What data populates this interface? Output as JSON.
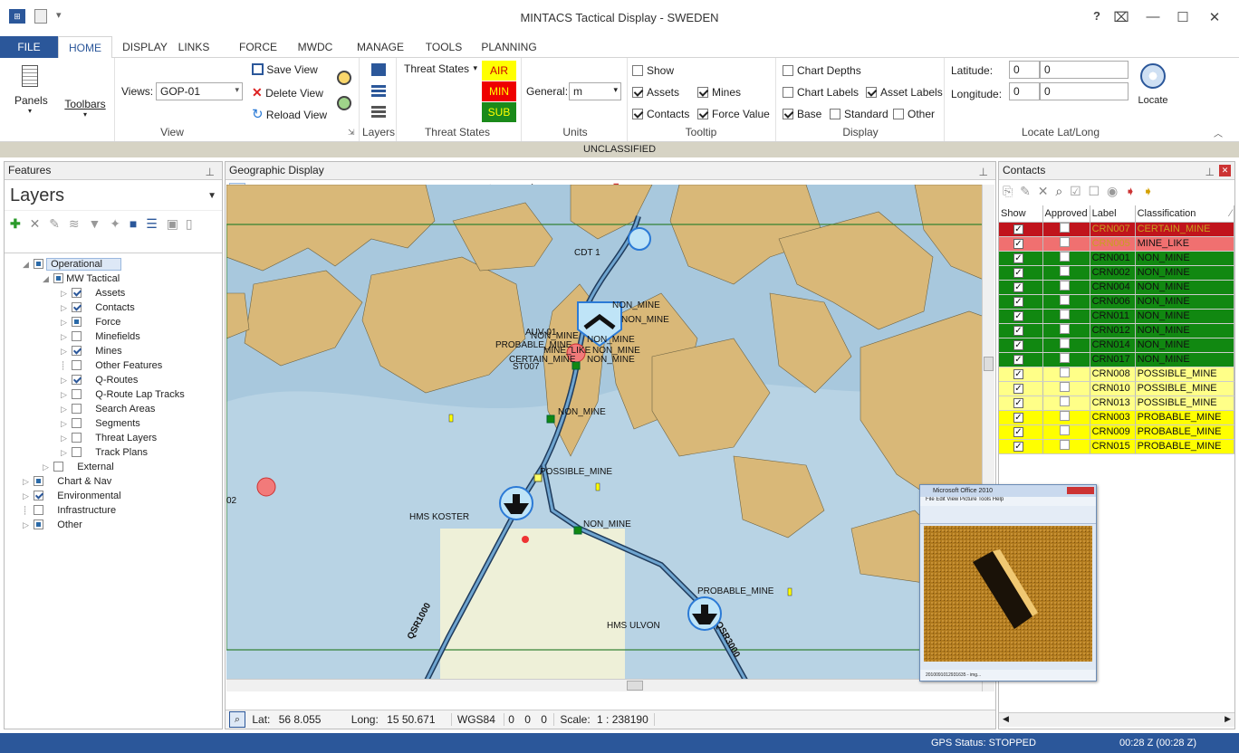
{
  "window": {
    "title": "MINTACS Tactical Display - SWEDEN",
    "help": "?",
    "restore": "⌧",
    "minimize": "—",
    "maximize": "☐",
    "close": "✕"
  },
  "tabs": [
    "FILE",
    "HOME",
    "DISPLAY",
    "LINKS",
    "FORCE",
    "MWDC",
    "MANAGE",
    "TOOLS",
    "PLANNING"
  ],
  "ribbon": {
    "panels": "Panels",
    "toolbars": "Toolbars",
    "views_label": "Views:",
    "views_value": "GOP-01",
    "save_view": "Save View",
    "delete_view": "Delete View",
    "reload_view": "Reload View",
    "view_group": "View",
    "layers_group": "Layers",
    "threat_states_select": "Threat States",
    "air": "AIR",
    "min": "MIN",
    "sub": "SUB",
    "threat_group": "Threat States",
    "general_label": "General:",
    "general_value": "m",
    "units_group": "Units",
    "tt_show": "Show",
    "tt_assets": "Assets",
    "tt_mines": "Mines",
    "tt_contacts": "Contacts",
    "tt_force": "Force Value",
    "tooltip_group": "Tooltip",
    "chart_depths": "Chart Depths",
    "chart_labels": "Chart Labels",
    "asset_labels": "Asset Labels",
    "base": "Base",
    "standard": "Standard",
    "other": "Other",
    "display_group": "Display",
    "latitude": "Latitude:",
    "longitude": "Longitude:",
    "lat_deg": "0",
    "lat_min": "0",
    "lon_deg": "0",
    "lon_min": "0",
    "locate": "Locate",
    "locate_group": "Locate Lat/Long"
  },
  "classification": "UNCLASSIFIED",
  "features": {
    "title": "Features",
    "dropdown": "Layers",
    "tree": [
      {
        "label": "Operational",
        "indent": 0
      },
      {
        "label": "MW Tactical",
        "indent": 1
      },
      {
        "label": "Assets",
        "indent": 2
      },
      {
        "label": "Contacts",
        "indent": 2
      },
      {
        "label": "Force",
        "indent": 2
      },
      {
        "label": "Minefields",
        "indent": 2
      },
      {
        "label": "Mines",
        "indent": 2
      },
      {
        "label": "Other Features",
        "indent": 2
      },
      {
        "label": "Q-Routes",
        "indent": 2
      },
      {
        "label": "Q-Route Lap Tracks",
        "indent": 2
      },
      {
        "label": "Search Areas",
        "indent": 2
      },
      {
        "label": "Segments",
        "indent": 2
      },
      {
        "label": "Threat Layers",
        "indent": 2
      },
      {
        "label": "Track Plans",
        "indent": 2
      },
      {
        "label": "External",
        "indent": 1
      },
      {
        "label": "Chart & Nav",
        "indent": 0
      },
      {
        "label": "Environmental",
        "indent": 0
      },
      {
        "label": "Infrastructure",
        "indent": 0
      },
      {
        "label": "Other",
        "indent": 0
      }
    ]
  },
  "geo": {
    "title": "Geographic Display",
    "labels": {
      "cdt": "CDT 1",
      "auv": "AUV-01",
      "st007": "ST007",
      "hms_koster": "HMS KOSTER",
      "hms_ulvon": "HMS ULVON",
      "non_mine": "NON_MINE",
      "probable_mine": "PROBABLE_MINE",
      "possible_mine": "POSSIBLE_MINE",
      "certain_mine": "CERTAIN_MINE",
      "mine_like": "MINE_LIKE",
      "qsr1000": "QSR1000",
      "qsr3000": "QSR3000",
      "label_02": "02"
    },
    "status": {
      "lat_label": "Lat:",
      "lat": "56 8.055",
      "long_label": "Long:",
      "long": "15 50.671",
      "datum": "WGS84",
      "z1": "0",
      "z2": "0",
      "z3": "0",
      "scale_label": "Scale:",
      "scale": "1 : 238190"
    }
  },
  "contacts": {
    "title": "Contacts",
    "headers": {
      "show": "Show",
      "approved": "Approved",
      "label": "Label",
      "classification": "Classification"
    },
    "rows": [
      {
        "label": "CRN007",
        "cls": "CERTAIN_MINE",
        "bg": "#c0141c",
        "fg": "#c8a020"
      },
      {
        "label": "CRN005",
        "cls": "MINE_LIKE",
        "bg": "#f07070",
        "fg": "#111"
      },
      {
        "label": "CRN001",
        "cls": "NON_MINE",
        "bg": "#118811",
        "fg": "#111"
      },
      {
        "label": "CRN002",
        "cls": "NON_MINE",
        "bg": "#118811",
        "fg": "#111"
      },
      {
        "label": "CRN004",
        "cls": "NON_MINE",
        "bg": "#118811",
        "fg": "#111"
      },
      {
        "label": "CRN006",
        "cls": "NON_MINE",
        "bg": "#118811",
        "fg": "#111"
      },
      {
        "label": "CRN011",
        "cls": "NON_MINE",
        "bg": "#118811",
        "fg": "#111"
      },
      {
        "label": "CRN012",
        "cls": "NON_MINE",
        "bg": "#118811",
        "fg": "#111"
      },
      {
        "label": "CRN014",
        "cls": "NON_MINE",
        "bg": "#118811",
        "fg": "#111"
      },
      {
        "label": "CRN017",
        "cls": "NON_MINE",
        "bg": "#118811",
        "fg": "#111"
      },
      {
        "label": "CRN008",
        "cls": "POSSIBLE_MINE",
        "bg": "#ffff88",
        "fg": "#111"
      },
      {
        "label": "CRN010",
        "cls": "POSSIBLE_MINE",
        "bg": "#ffff88",
        "fg": "#111"
      },
      {
        "label": "CRN013",
        "cls": "POSSIBLE_MINE",
        "bg": "#ffff88",
        "fg": "#111"
      },
      {
        "label": "CRN003",
        "cls": "PROBABLE_MINE",
        "bg": "#ffff00",
        "fg": "#111"
      },
      {
        "label": "CRN009",
        "cls": "PROBABLE_MINE",
        "bg": "#ffff00",
        "fg": "#111"
      },
      {
        "label": "CRN015",
        "cls": "PROBABLE_MINE",
        "bg": "#ffff00",
        "fg": "#111"
      }
    ]
  },
  "office": {
    "title": "Microsoft Office 2010",
    "menu": "File Edit View Picture Tools Help",
    "file": "2010091012931635 - img..."
  },
  "statusbar": {
    "gps": "GPS Status: STOPPED",
    "time": "00:28 Z (00:28 Z)"
  }
}
